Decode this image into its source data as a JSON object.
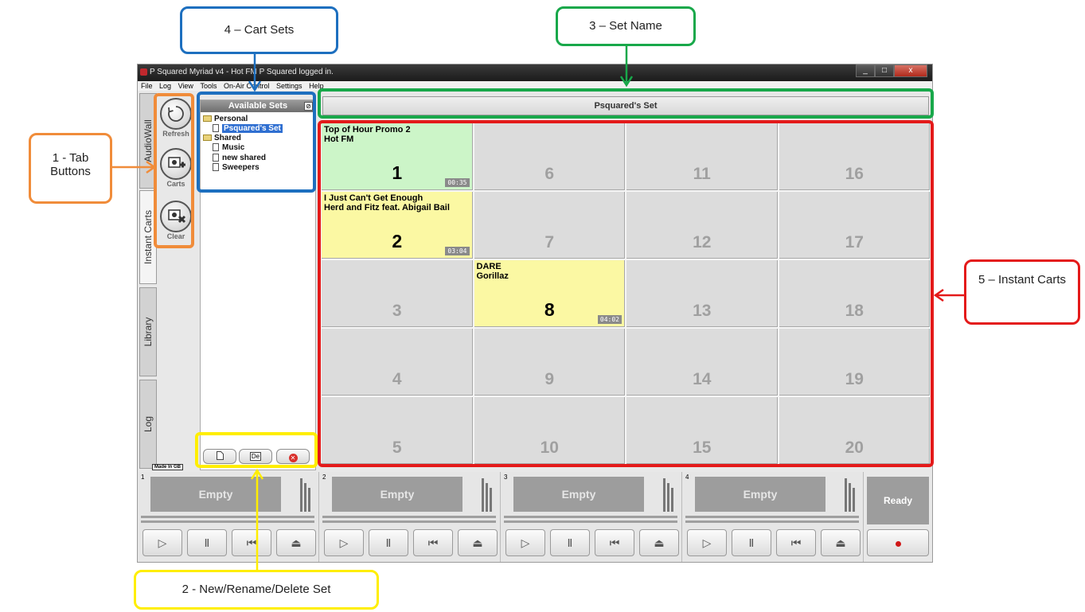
{
  "window": {
    "title": "P Squared Myriad v4 - Hot FM P Squared logged in.",
    "controls": [
      "_",
      "□",
      "x"
    ]
  },
  "menu": [
    "File",
    "Log",
    "View",
    "Tools",
    "On-Air Control",
    "Settings",
    "Help"
  ],
  "side_tabs": [
    "AudioWall",
    "Instant Carts",
    "Library",
    "Log"
  ],
  "made_in": "Made In GB",
  "tool_buttons": [
    {
      "label": "Refresh",
      "icon": "refresh-icon"
    },
    {
      "label": "Carts",
      "icon": "cart-add-icon"
    },
    {
      "label": "Clear",
      "icon": "cart-clear-icon"
    }
  ],
  "sets_panel": {
    "header": "Available Sets",
    "groups": [
      {
        "name": "Personal",
        "items": [
          "Psquared's Set"
        ]
      },
      {
        "name": "Shared",
        "items": [
          "Music",
          "new shared",
          "Sweepers"
        ]
      }
    ],
    "selected": "Psquared's Set",
    "buttons": [
      "new-set",
      "De",
      "delete-set"
    ]
  },
  "set_name": "Psquared's Set",
  "carts": [
    {
      "n": "1",
      "title": "Top of Hour Promo 2",
      "artist": "Hot FM",
      "duration": "00:35",
      "color": "#ccf5c8"
    },
    {
      "n": "2",
      "title": "I Just Can't Get Enough",
      "artist": "Herd and Fitz feat. Abigail Bail",
      "duration": "03:04",
      "color": "#fbf8a3"
    },
    {
      "n": "3"
    },
    {
      "n": "4"
    },
    {
      "n": "5"
    },
    {
      "n": "6"
    },
    {
      "n": "7"
    },
    {
      "n": "8",
      "title": "DARE",
      "artist": "Gorillaz",
      "duration": "04:02",
      "color": "#fbf8a3"
    },
    {
      "n": "9"
    },
    {
      "n": "10"
    },
    {
      "n": "11"
    },
    {
      "n": "12"
    },
    {
      "n": "13"
    },
    {
      "n": "14"
    },
    {
      "n": "15"
    },
    {
      "n": "16"
    },
    {
      "n": "17"
    },
    {
      "n": "18"
    },
    {
      "n": "19"
    },
    {
      "n": "20"
    }
  ],
  "players": [
    {
      "n": "1",
      "status": "Empty"
    },
    {
      "n": "2",
      "status": "Empty"
    },
    {
      "n": "3",
      "status": "Empty"
    },
    {
      "n": "4",
      "status": "Empty"
    }
  ],
  "ready_label": "Ready",
  "annotations": {
    "tab_buttons": "1 - Tab Buttons",
    "new_rename_delete": "2 - New/Rename/Delete Set",
    "set_name": "3 – Set Name",
    "cart_sets": "4 – Cart Sets",
    "instant_carts": "5 – Instant Carts",
    "colors": {
      "orange": "#f08c3a",
      "yellow": "#ffee00",
      "green": "#18a84a",
      "blue": "#1d6fbf",
      "red": "#e41a1a"
    }
  }
}
